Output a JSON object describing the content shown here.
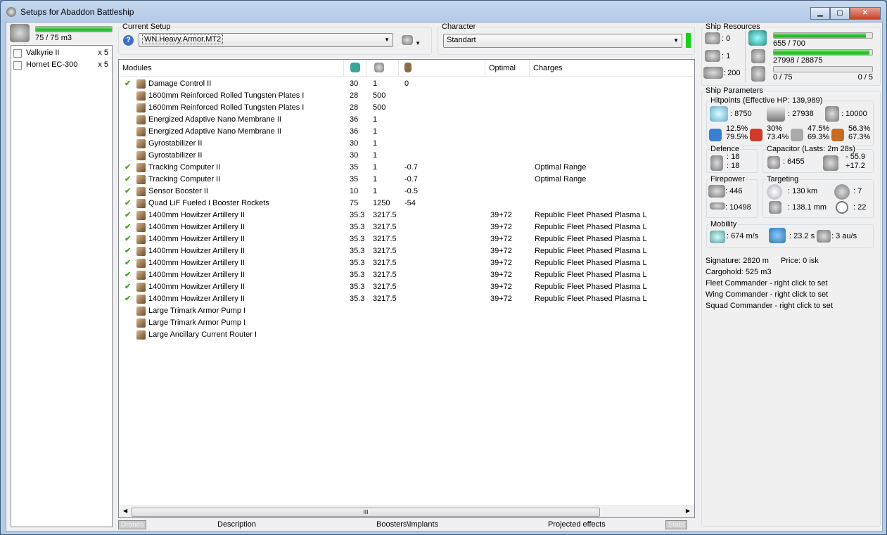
{
  "window": {
    "title": "Setups for Abaddon Battleship",
    "minimize": "▁",
    "maximize": "▢",
    "close": "✕"
  },
  "drone_bay": {
    "usage": "75 / 75 m3",
    "fraction": 1.0,
    "drones": [
      {
        "name": "Valkyrie II",
        "qty": "x 5"
      },
      {
        "name": "Hornet EC-300",
        "qty": "x 5"
      }
    ]
  },
  "setup": {
    "label": "Current Setup",
    "value": "WN.Heavy.Armor.MT2"
  },
  "character": {
    "label": "Character",
    "value": "Standart"
  },
  "modules": {
    "headers": [
      "Modules",
      "",
      "",
      "",
      "Optimal",
      "Charges"
    ],
    "rows": [
      {
        "check": "✔",
        "name": "Damage Control II",
        "c1": "30",
        "c2": "1",
        "c3": "0",
        "optimal": "",
        "charges": ""
      },
      {
        "check": "",
        "name": "1600mm Reinforced Rolled Tungsten Plates I",
        "c1": "28",
        "c2": "500",
        "c3": "",
        "optimal": "",
        "charges": ""
      },
      {
        "check": "",
        "name": "1600mm Reinforced Rolled Tungsten Plates I",
        "c1": "28",
        "c2": "500",
        "c3": "",
        "optimal": "",
        "charges": ""
      },
      {
        "check": "",
        "name": "Energized Adaptive Nano Membrane II",
        "c1": "36",
        "c2": "1",
        "c3": "",
        "optimal": "",
        "charges": ""
      },
      {
        "check": "",
        "name": "Energized Adaptive Nano Membrane II",
        "c1": "36",
        "c2": "1",
        "c3": "",
        "optimal": "",
        "charges": ""
      },
      {
        "check": "",
        "name": "Gyrostabilizer II",
        "c1": "30",
        "c2": "1",
        "c3": "",
        "optimal": "",
        "charges": ""
      },
      {
        "check": "",
        "name": "Gyrostabilizer II",
        "c1": "30",
        "c2": "1",
        "c3": "",
        "optimal": "",
        "charges": ""
      },
      {
        "check": "✔",
        "name": "Tracking Computer II",
        "c1": "35",
        "c2": "1",
        "c3": "-0.7",
        "optimal": "",
        "charges": "Optimal Range"
      },
      {
        "check": "✔",
        "name": "Tracking Computer II",
        "c1": "35",
        "c2": "1",
        "c3": "-0.7",
        "optimal": "",
        "charges": "Optimal Range"
      },
      {
        "check": "✔",
        "name": "Sensor Booster II",
        "c1": "10",
        "c2": "1",
        "c3": "-0.5",
        "optimal": "",
        "charges": ""
      },
      {
        "check": "✔",
        "name": "Quad LiF Fueled I Booster Rockets",
        "c1": "75",
        "c2": "1250",
        "c3": "-54",
        "optimal": "",
        "charges": ""
      },
      {
        "check": "✔",
        "name": "1400mm Howitzer Artillery II",
        "c1": "35.3",
        "c2": "3217.5",
        "c3": "",
        "optimal": "39+72",
        "charges": "Republic Fleet Phased Plasma L"
      },
      {
        "check": "✔",
        "name": "1400mm Howitzer Artillery II",
        "c1": "35.3",
        "c2": "3217.5",
        "c3": "",
        "optimal": "39+72",
        "charges": "Republic Fleet Phased Plasma L"
      },
      {
        "check": "✔",
        "name": "1400mm Howitzer Artillery II",
        "c1": "35.3",
        "c2": "3217.5",
        "c3": "",
        "optimal": "39+72",
        "charges": "Republic Fleet Phased Plasma L"
      },
      {
        "check": "✔",
        "name": "1400mm Howitzer Artillery II",
        "c1": "35.3",
        "c2": "3217.5",
        "c3": "",
        "optimal": "39+72",
        "charges": "Republic Fleet Phased Plasma L"
      },
      {
        "check": "✔",
        "name": "1400mm Howitzer Artillery II",
        "c1": "35.3",
        "c2": "3217.5",
        "c3": "",
        "optimal": "39+72",
        "charges": "Republic Fleet Phased Plasma L"
      },
      {
        "check": "✔",
        "name": "1400mm Howitzer Artillery II",
        "c1": "35.3",
        "c2": "3217.5",
        "c3": "",
        "optimal": "39+72",
        "charges": "Republic Fleet Phased Plasma L"
      },
      {
        "check": "✔",
        "name": "1400mm Howitzer Artillery II",
        "c1": "35.3",
        "c2": "3217.5",
        "c3": "",
        "optimal": "39+72",
        "charges": "Republic Fleet Phased Plasma L"
      },
      {
        "check": "✔",
        "name": "1400mm Howitzer Artillery II",
        "c1": "35.3",
        "c2": "3217.5",
        "c3": "",
        "optimal": "39+72",
        "charges": "Republic Fleet Phased Plasma L"
      },
      {
        "check": "",
        "name": "Large Trimark Armor Pump I",
        "c1": "",
        "c2": "",
        "c3": "",
        "optimal": "",
        "charges": ""
      },
      {
        "check": "",
        "name": "Large Trimark Armor Pump I",
        "c1": "",
        "c2": "",
        "c3": "",
        "optimal": "",
        "charges": ""
      },
      {
        "check": "",
        "name": "Large Ancillary Current Router I",
        "c1": "",
        "c2": "",
        "c3": "",
        "optimal": "",
        "charges": ""
      }
    ],
    "scroll_grip": "III"
  },
  "bottom_tabs": {
    "drones": "Drones",
    "description": "Description",
    "boosters": "Boosters\\Implants",
    "projected": "Projected effects",
    "stats": "Stats"
  },
  "resources": {
    "label": "Ship Resources",
    "turrets": ": 0",
    "launchers": ": 1",
    "calibration": ": 200",
    "cpu": {
      "text": "655 / 700",
      "fraction": 0.936
    },
    "power": {
      "text": "27998 / 28875",
      "fraction": 0.97
    },
    "drone_bw": {
      "text": "0 / 75",
      "fraction": 0
    },
    "drones_active": "0 / 5"
  },
  "parameters": {
    "label": "Ship Parameters",
    "hitpoints": {
      "label": "Hitpoints (Effective HP: 139,989)",
      "shield": ": 8750",
      "armor": ": 27938",
      "structure": ": 10000",
      "resists": [
        {
          "a": "12.5%",
          "b": "79.5%"
        },
        {
          "a": "30%",
          "b": "73.4%"
        },
        {
          "a": "47.5%",
          "b": "69.3%"
        },
        {
          "a": "56.3%",
          "b": "67.3%"
        }
      ]
    },
    "defence": {
      "label": "Defence",
      "a": ": 18",
      "b": ": 18"
    },
    "capacitor": {
      "label": "Capacitor (Lasts: 2m 28s)",
      "capacity": ": 6455",
      "drain": "- 55.9",
      "recharge": "+17.2"
    },
    "firepower": {
      "label": "Firepower",
      "dps": ": 446",
      "volley": ": 10498"
    },
    "targeting": {
      "label": "Targeting",
      "range": ": 130 km",
      "targets": ": 7",
      "sensor": ": 138.1 mm",
      "scan": ": 22"
    },
    "mobility": {
      "label": "Mobility",
      "speed": ": 674 m/s",
      "align": ": 23.2 s",
      "warp": ": 3 au/s"
    },
    "signature": "Signature: 2820 m",
    "price": "Price: 0 isk",
    "cargo": "Cargohold: 525 m3",
    "fleet": "Fleet Commander - right click to set",
    "wing": "Wing Commander - right click to set",
    "squad": "Squad Commander - right click to set"
  }
}
